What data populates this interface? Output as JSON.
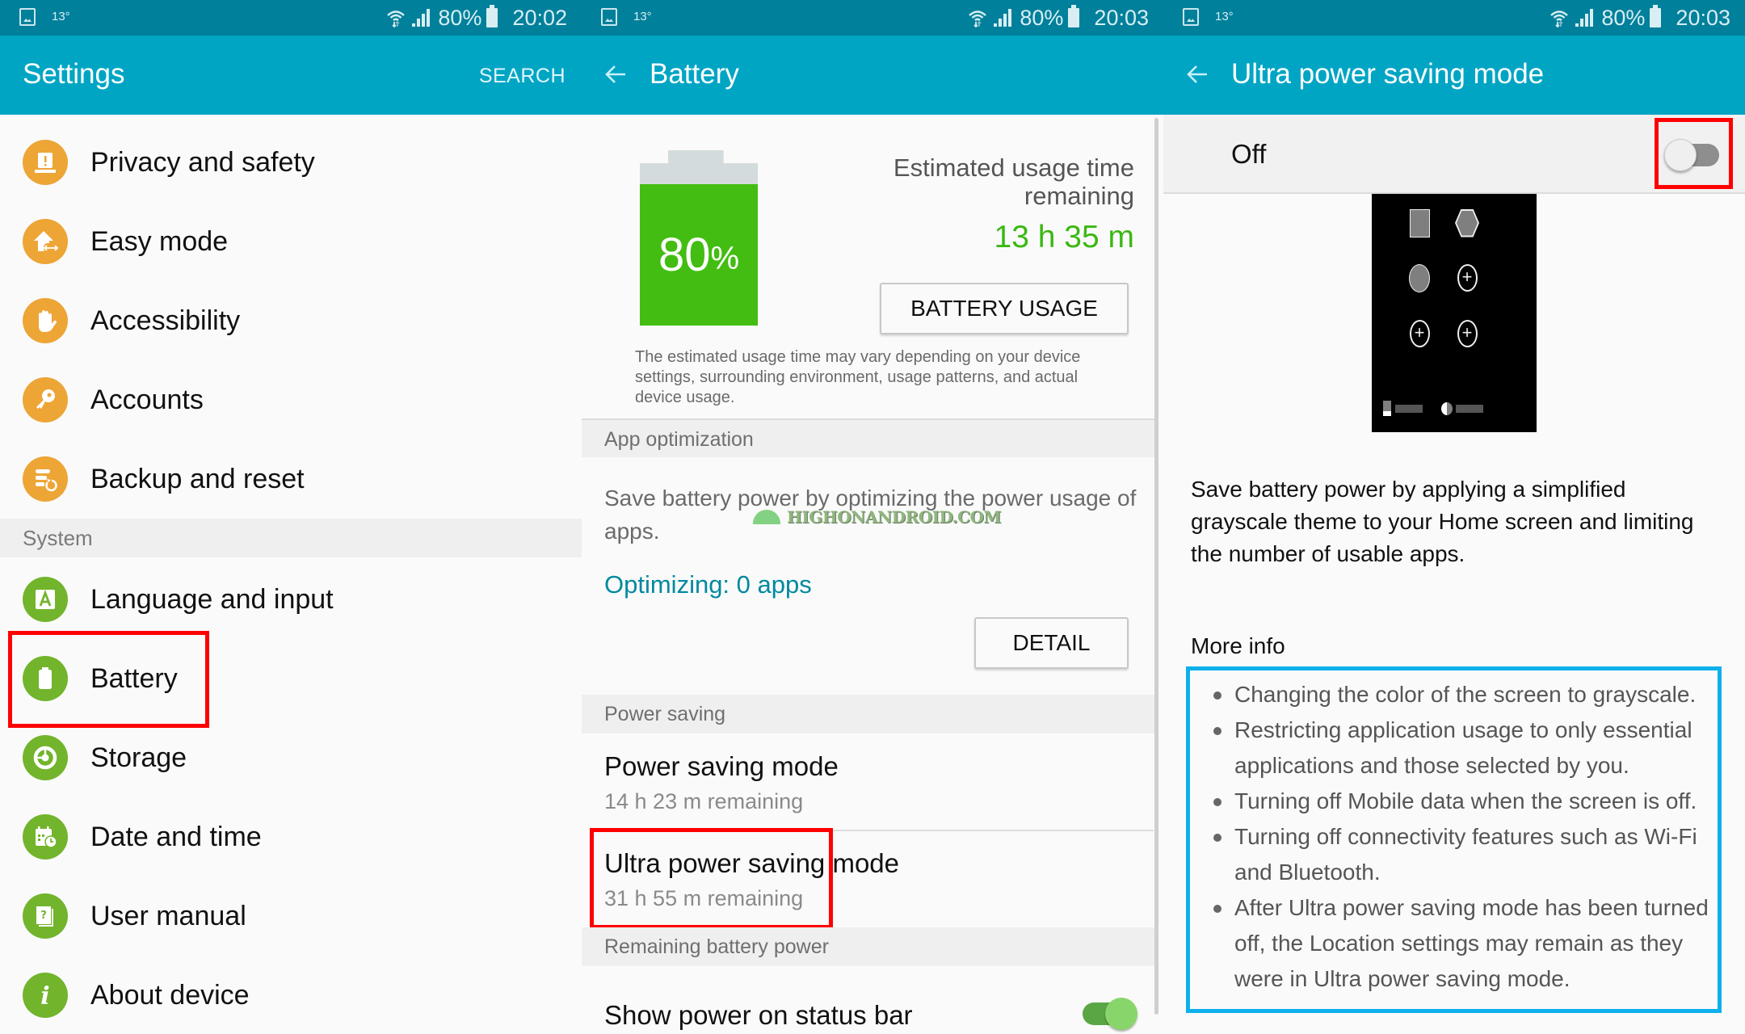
{
  "panels": [
    {
      "status": {
        "temp": "13°",
        "battery": "80%",
        "time": "20:02"
      },
      "appbar": {
        "title": "Settings",
        "action": "SEARCH"
      },
      "items_top": [
        {
          "label": "Privacy and safety",
          "icon": "privacy-alert-icon"
        },
        {
          "label": "Easy mode",
          "icon": "easy-mode-home-icon"
        },
        {
          "label": "Accessibility",
          "icon": "hand-icon"
        },
        {
          "label": "Accounts",
          "icon": "key-icon"
        },
        {
          "label": "Backup and reset",
          "icon": "backup-icon"
        }
      ],
      "section": "System",
      "items_system": [
        {
          "label": "Language and input",
          "icon": "language-a-icon"
        },
        {
          "label": "Battery",
          "icon": "battery-icon",
          "highlighted": true
        },
        {
          "label": "Storage",
          "icon": "storage-icon"
        },
        {
          "label": "Date and time",
          "icon": "calendar-clock-icon"
        },
        {
          "label": "User manual",
          "icon": "manual-question-icon"
        },
        {
          "label": "About device",
          "icon": "info-icon"
        }
      ],
      "colors": {
        "orange": "#eda536",
        "green": "#72b42c"
      }
    },
    {
      "status": {
        "temp": "13°",
        "battery": "80%",
        "time": "20:03"
      },
      "appbar": {
        "title": "Battery"
      },
      "battery": {
        "percent_value": "80",
        "percent_sign": "%",
        "level": 0.8,
        "estimate_label": "Estimated usage time remaining",
        "estimate_value": "13 h 35 m",
        "usage_button": "BATTERY USAGE",
        "note": "The estimated usage time may vary depending on your device settings, surrounding environment, usage patterns, and actual device usage."
      },
      "app_optimization": {
        "header": "App optimization",
        "description": "Save battery power by optimizing the power usage of apps.",
        "status": "Optimizing: 0 apps",
        "detail_button": "DETAIL"
      },
      "power_saving": {
        "header": "Power saving",
        "items": [
          {
            "title": "Power saving mode",
            "subtitle": "14 h 23 m remaining"
          },
          {
            "title": "Ultra power saving mode",
            "subtitle": "31 h 55 m remaining",
            "highlighted": true
          }
        ]
      },
      "remaining": {
        "header": "Remaining battery power",
        "show_on_status_bar": "Show power on status bar",
        "show_on_status_bar_enabled": true
      },
      "watermark": "HIGHONANDROID.COM"
    },
    {
      "status": {
        "temp": "13°",
        "battery": "80%",
        "time": "20:03"
      },
      "appbar": {
        "title": "Ultra power saving mode"
      },
      "switch": {
        "label": "Off",
        "enabled": false
      },
      "description": "Save battery power by applying a simplified grayscale theme to your Home screen and limiting the number of usable apps.",
      "more_info_label": "More info",
      "more_info": [
        "Changing the color of the screen to grayscale.",
        "Restricting application usage to only essential applications and those selected by you.",
        "Turning off Mobile data when the screen is off.",
        "Turning off connectivity features such as Wi-Fi and Bluetooth.",
        "After Ultra power saving mode has been turned off, the Location settings may remain as they were in Ultra power saving mode."
      ]
    }
  ],
  "colors": {
    "statusbar": "#00809b",
    "appbar": "#00a5c4",
    "highlight_red": "#ff0000",
    "highlight_blue": "#0eb0eb",
    "battery_green": "#43bd12"
  }
}
